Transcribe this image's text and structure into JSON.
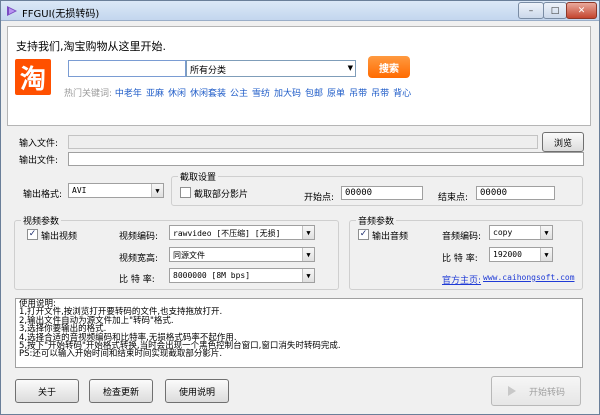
{
  "window": {
    "title": "FFGUI(无损转码)",
    "minimize": "–",
    "maximize": "□",
    "close": "✕"
  },
  "ad": {
    "slogan": "支持我们,淘宝购物从这里开始.",
    "logo_text": "淘",
    "search_value": "",
    "category": "所有分类",
    "search_button": "搜索",
    "hot_label": "热门关键词:",
    "hot_keywords": [
      "中老年",
      "亚麻",
      "休闲",
      "休闲套装",
      "公主",
      "雪纺",
      "加大码",
      "包邮",
      "原单",
      "吊带",
      "吊带",
      "背心"
    ]
  },
  "io": {
    "input_label": "输入文件:",
    "input_value": "",
    "browse_button": "浏览",
    "output_label": "输出文件:",
    "output_value": "",
    "format_label": "输出格式:",
    "format_value": "AVI"
  },
  "clip": {
    "group_title": "截取设置",
    "partial_label": "截取部分影片",
    "partial_checked": false,
    "start_label": "开始点:",
    "start_value": "00000",
    "end_label": "结束点:",
    "end_value": "00000"
  },
  "video": {
    "group_title": "视频参数",
    "output_label": "输出视频",
    "output_checked": true,
    "codec_label": "视频编码:",
    "codec_value": "rawvideo  [不压缩]  [无损]",
    "size_label": "视频宽高:",
    "size_value": "同源文件",
    "bitrate_label": "比 特 率:",
    "bitrate_value": "8000000   [8M bps]"
  },
  "audio": {
    "group_title": "音频参数",
    "output_label": "输出音频",
    "output_checked": true,
    "codec_label": "音频编码:",
    "codec_value": "copy",
    "bitrate_label": "比 特 率:",
    "bitrate_value": "192000",
    "homepage_label": "官方主页:",
    "homepage_url": "www.caihongsoft.com"
  },
  "notes": [
    "使用说明:",
    "1,打开文件,按浏览打开要转码的文件,也支持拖放打开.",
    "2,输出文件自动为源文件加上\"转码\"格式.",
    "3,选择你要输出的格式.",
    "4,选择合适的音视频编码和比特率,无损格式码率不起作用.",
    "5,按下\"开始转码\"开始格式转换,当时会出现一个黑色控制台窗口,窗口消失时转码完成.",
    "PS:还可以输入开始时间和结束时间实现截取部分影片."
  ],
  "footer": {
    "about": "关于",
    "check_update": "检查更新",
    "help": "使用说明",
    "start": "开始转码",
    "start_icon": "play-arrow-icon"
  }
}
